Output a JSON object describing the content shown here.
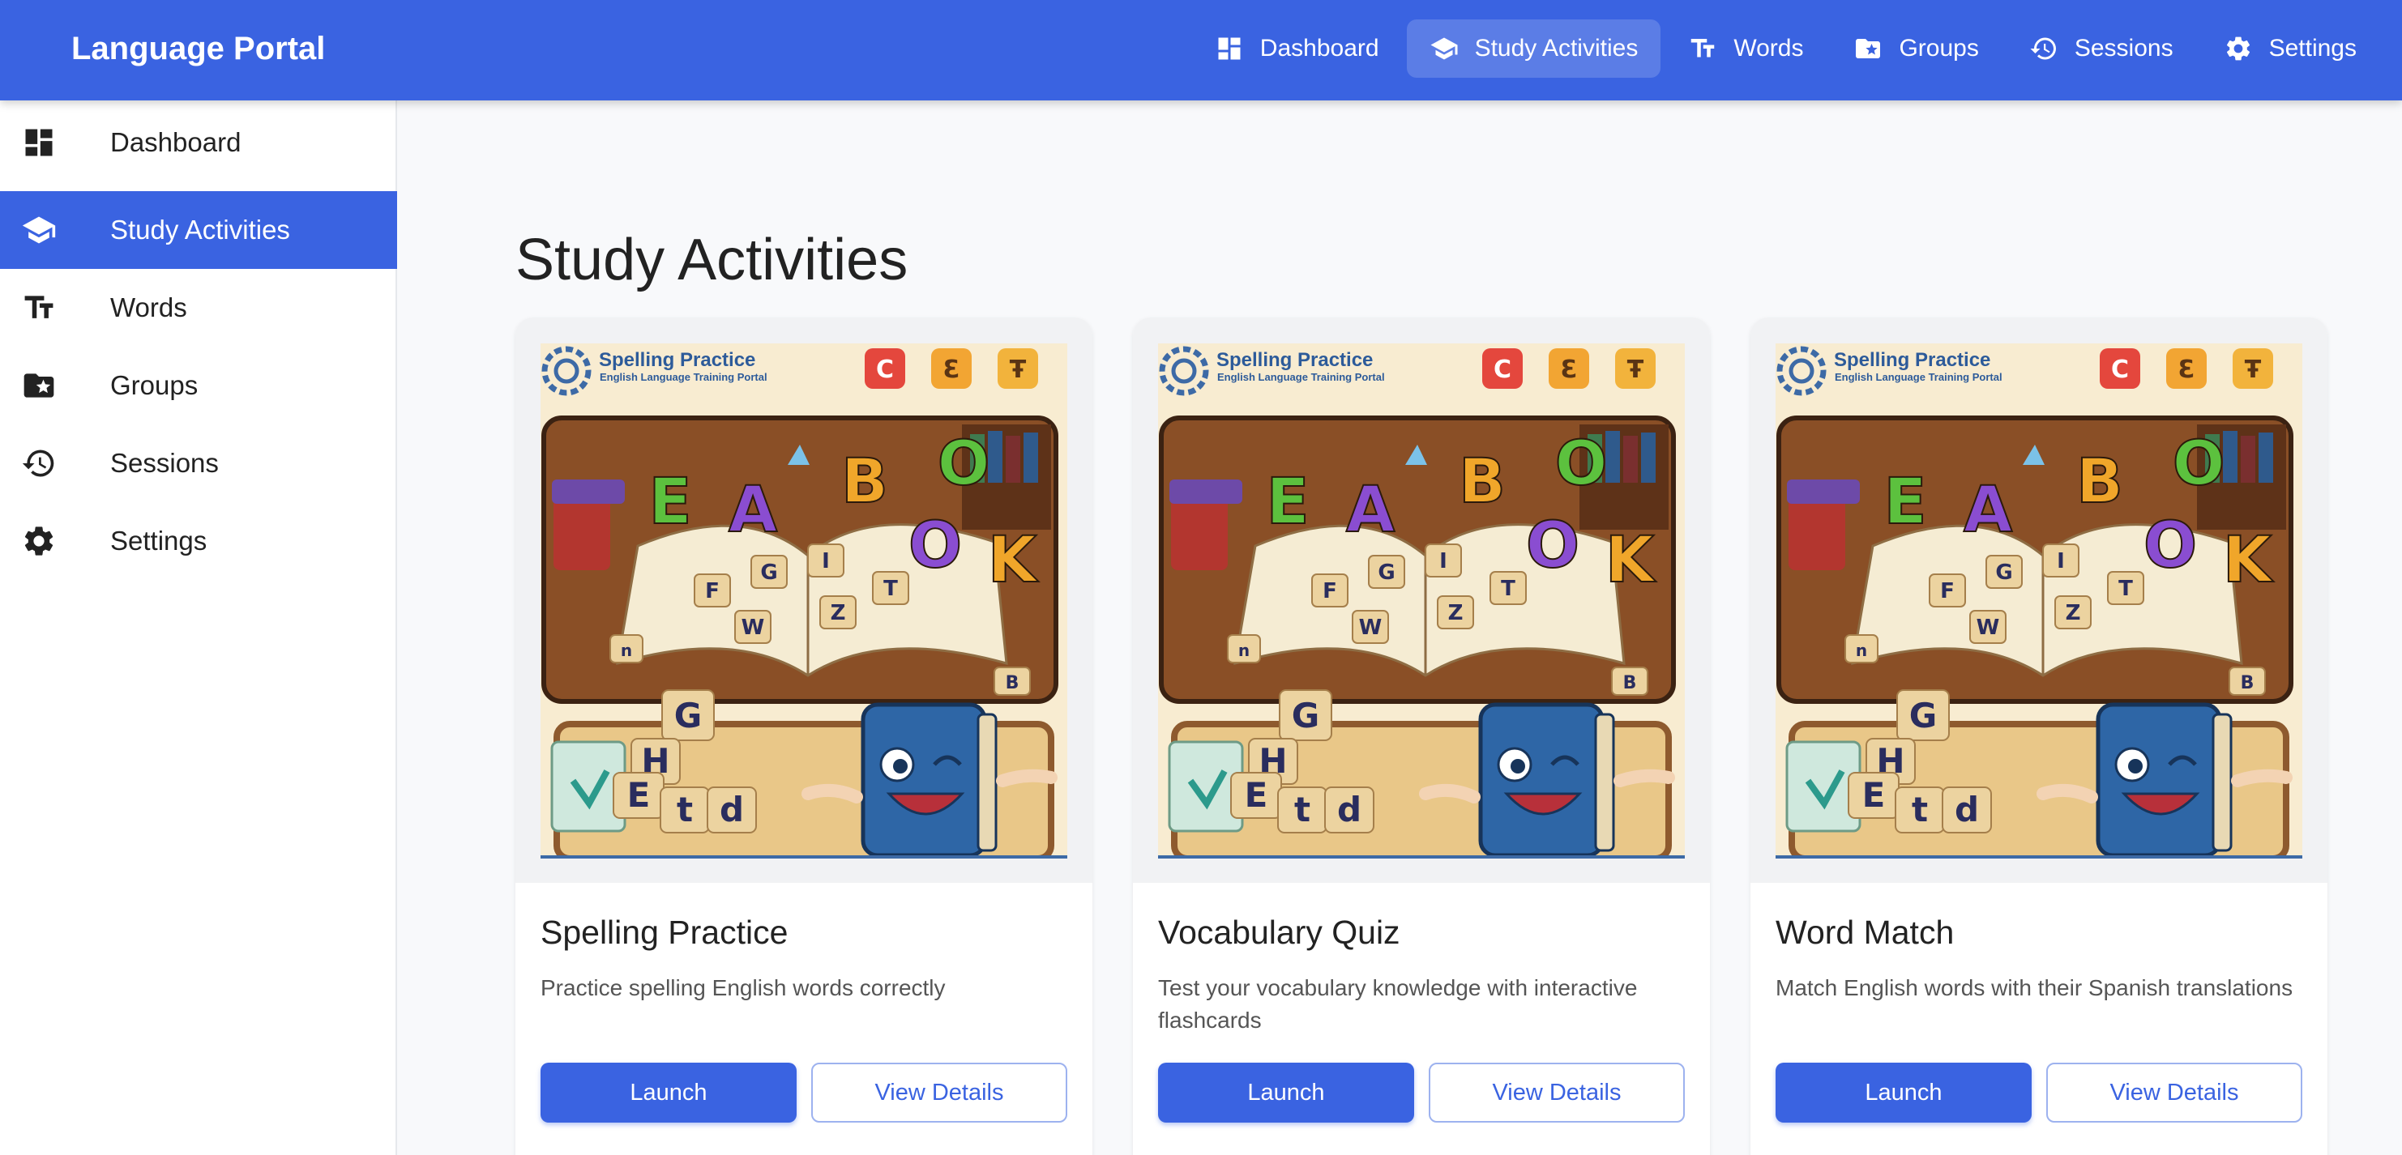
{
  "app": {
    "title": "Language Portal"
  },
  "topnav": [
    {
      "label": "Dashboard",
      "icon": "dashboard-icon"
    },
    {
      "label": "Study Activities",
      "icon": "school-icon"
    },
    {
      "label": "Words",
      "icon": "text-fields-icon"
    },
    {
      "label": "Groups",
      "icon": "folder-star-icon"
    },
    {
      "label": "Sessions",
      "icon": "history-icon"
    },
    {
      "label": "Settings",
      "icon": "gear-icon"
    }
  ],
  "sidebar": {
    "items": [
      {
        "label": "Dashboard",
        "icon": "dashboard-icon"
      },
      {
        "label": "Study Activities",
        "icon": "school-icon"
      },
      {
        "label": "Words",
        "icon": "text-fields-icon"
      },
      {
        "label": "Groups",
        "icon": "folder-star-icon"
      },
      {
        "label": "Sessions",
        "icon": "history-icon"
      },
      {
        "label": "Settings",
        "icon": "gear-icon"
      }
    ],
    "active": "Study Activities"
  },
  "main": {
    "title": "Study Activities",
    "cards": [
      {
        "title": "Spelling Practice",
        "description": "Practice spelling English words correctly",
        "launch_label": "Launch",
        "details_label": "View Details",
        "art": {
          "heading": "Spelling Practice",
          "subheading": "English Language Training Portal",
          "badges": [
            "C",
            "Ɛ",
            "Ŧ"
          ]
        }
      },
      {
        "title": "Vocabulary Quiz",
        "description": "Test your vocabulary knowledge with interactive flashcards",
        "launch_label": "Launch",
        "details_label": "View Details",
        "art": {
          "heading": "Spelling Practice",
          "subheading": "English Language Training Portal",
          "badges": [
            "C",
            "Ɛ",
            "Ŧ"
          ]
        }
      },
      {
        "title": "Word Match",
        "description": "Match English words with their Spanish translations",
        "launch_label": "Launch",
        "details_label": "View Details",
        "art": {
          "heading": "Spelling Practice",
          "subheading": "English Language Training Portal",
          "badges": [
            "C",
            "Ɛ",
            "Ŧ"
          ]
        }
      }
    ]
  },
  "colors": {
    "primary": "#3a63e1",
    "background": "#f8f9fb",
    "sidebar_border": "#e6e8ec"
  }
}
